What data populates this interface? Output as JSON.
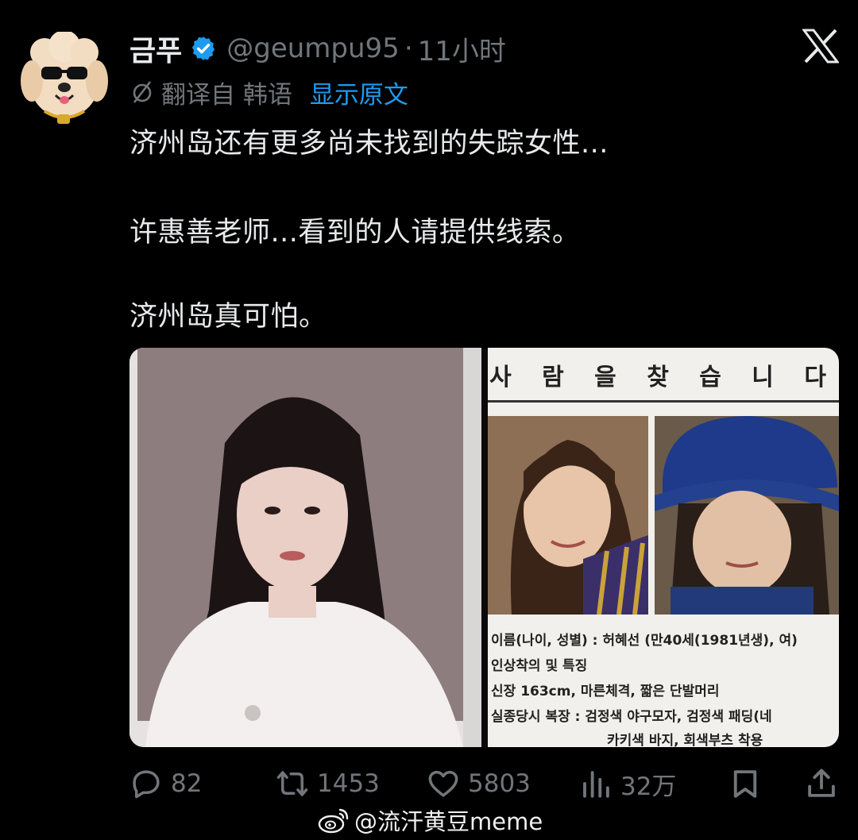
{
  "tweet": {
    "author": {
      "display_name": "금푸",
      "handle": "@geumpu95",
      "separator": "·",
      "time": "11小时",
      "verified": true,
      "avatar_icon": "sunglasses-poodle-avatar"
    },
    "platform_icon": "x-logo-icon",
    "translation": {
      "label": "翻译自 韩语",
      "show_original": "显示原文"
    },
    "body": {
      "line1": "济州岛还有更多尚未找到的失踪女性...",
      "line2": "许惠善老师...看到的人请提供线索。",
      "line3": "济州岛真可怕。"
    },
    "media": {
      "poster": {
        "title": "사 람 을 찾 습 니 다",
        "info_line1": "이름(나이, 성별) : 허혜선 (만40세(1981년생), 여)",
        "info_line2": "인상착의 및 특징",
        "info_line3": "신장 163cm, 마른체격, 짧은 단발머리",
        "info_line4": "실종당시 복장 : 검정색 야구모자, 검정색 패딩(네",
        "info_line5": "카키색 바지, 회색부츠 착용"
      }
    },
    "actions": {
      "replies": "82",
      "retweets": "1453",
      "likes": "5803",
      "views": "32万"
    }
  },
  "watermark": {
    "text": "@流汗黄豆meme",
    "icon": "weibo-icon"
  },
  "colors": {
    "background": "#000000",
    "text_primary": "#e7e9ea",
    "text_secondary": "#71767b",
    "link_blue": "#1d9bf0",
    "verified_blue": "#1d9bf0"
  }
}
